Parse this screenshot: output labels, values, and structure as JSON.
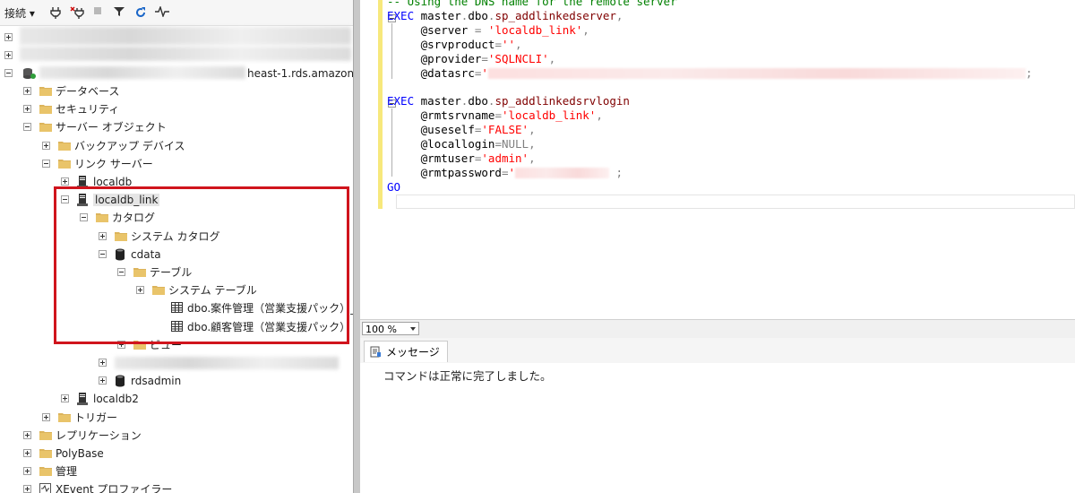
{
  "toolbar": {
    "connect_label": "接続 ▾"
  },
  "tree": {
    "server_suffix": "heast-1.rds.amazon",
    "items": [
      "データベース",
      "セキュリティ",
      "サーバー オブジェクト",
      "バックアップ デバイス",
      "リンク サーバー",
      "localdb",
      "localdb_link",
      "カタログ",
      "システム カタログ",
      "cdata",
      "テーブル",
      "システム テーブル",
      "dbo.案件管理（営業支援パック）_",
      "dbo.顧客管理（営業支援パック）",
      "ビュー",
      "rdsadmin",
      "localdb2",
      "トリガー",
      "レプリケーション",
      "PolyBase",
      "管理",
      "XEvent プロファイラー"
    ]
  },
  "editor": {
    "comment": "-- Using the DNS name for the remote server",
    "exec1_kw": "EXEC",
    "exec1_obj": "master",
    "exec1_schema": "dbo",
    "exec1_proc": "sp_addlinkedserver",
    "p_server": "@server",
    "v_server": "'localdb_link'",
    "p_srvproduct": "@srvproduct",
    "v_srvproduct": "''",
    "p_provider": "@provider",
    "v_provider": "'SQLNCLI'",
    "p_datasrc": "@datasrc",
    "v_datasrc_start": "'",
    "exec2_kw": "EXEC",
    "exec2_obj": "master",
    "exec2_schema": "dbo",
    "exec2_proc": "sp_addlinkedsrvlogin",
    "p_rmtsrvname": "@rmtsrvname",
    "v_rmtsrvname": "'localdb_link'",
    "p_useself": "@useself",
    "v_useself": "'FALSE'",
    "p_locallogin": "@locallogin",
    "v_locallogin": "NULL",
    "p_rmtuser": "@rmtuser",
    "v_rmtuser": "'admin'",
    "p_rmtpassword": "@rmtpassword",
    "v_rmtpassword_start": "'",
    "go": "GO"
  },
  "zoom": {
    "value": "100 %"
  },
  "results": {
    "tab_label": "メッセージ",
    "message": "コマンドは正常に完了しました。"
  },
  "colors": {
    "keyword": "#0000ff",
    "string": "#ff0000",
    "highlight_box": "#d0141d",
    "change_bar": "#f7e87c"
  }
}
